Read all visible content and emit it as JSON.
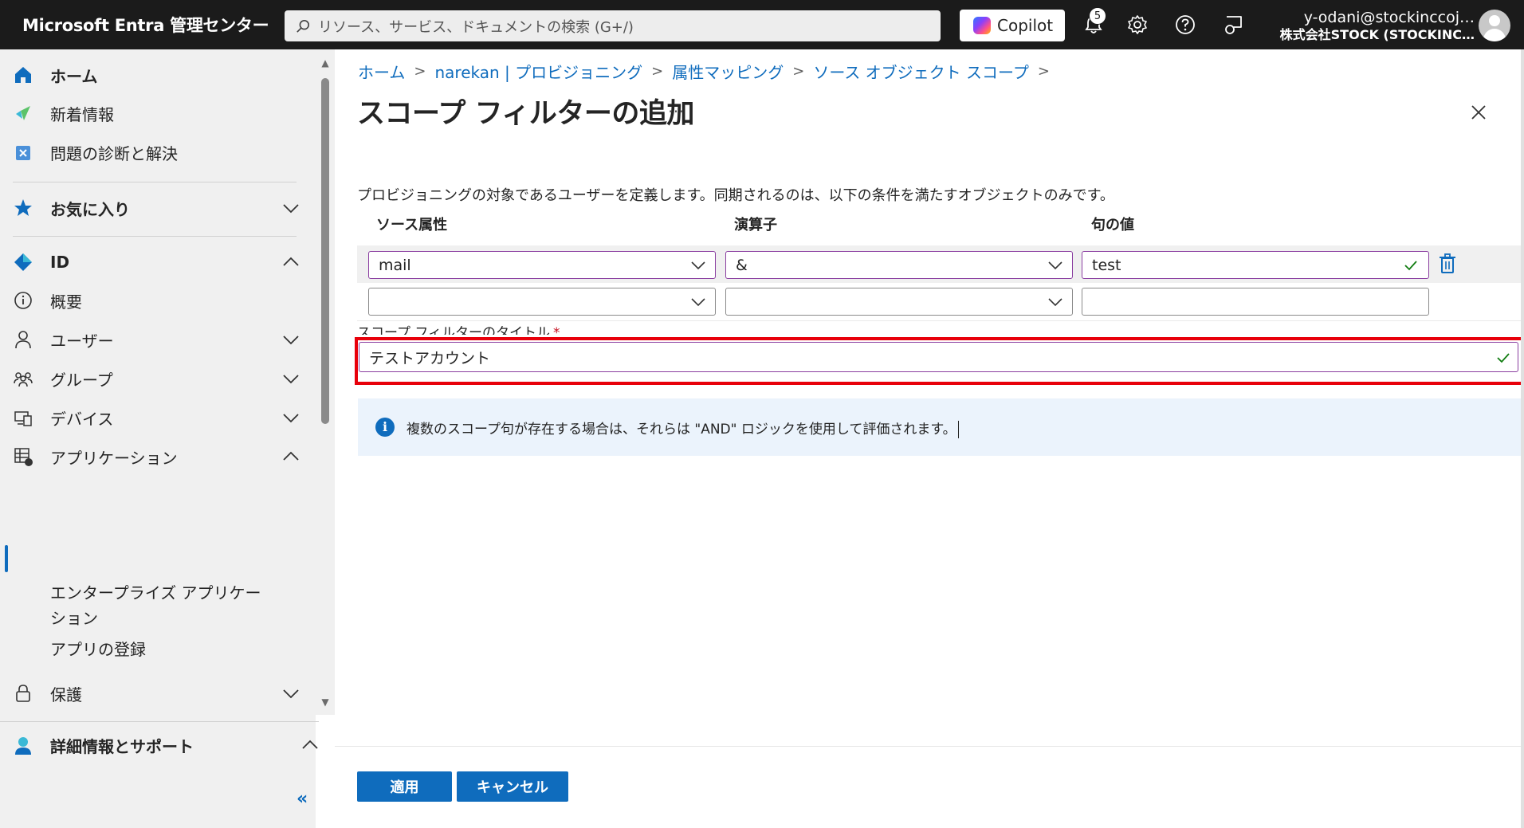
{
  "topbar": {
    "brand": "Microsoft Entra 管理センター",
    "search_placeholder": "リソース、サービス、ドキュメントの検索 (G+/)",
    "copilot_label": "Copilot",
    "notification_count": "5",
    "user_email": "y-odani@stockinccoj…",
    "user_org": "株式会社STOCK (STOCKINC…"
  },
  "sidebar": {
    "home": "ホーム",
    "whats_new": "新着情報",
    "diagnose": "問題の診断と解決",
    "favorites": "お気に入り",
    "identity": "ID",
    "overview": "概要",
    "users": "ユーザー",
    "groups": "グループ",
    "devices": "デバイス",
    "applications": "アプリケーション",
    "enterprise_apps": "エンタープライズ アプリケーション",
    "app_registrations": "アプリの登録",
    "protection": "保護",
    "learn_support": "詳細情報とサポート",
    "collapse_label": "«"
  },
  "breadcrumb": [
    "ホーム",
    "narekan | プロビジョニング",
    "属性マッピング",
    "ソース オブジェクト スコープ"
  ],
  "page": {
    "title": "スコープ フィルターの追加",
    "more": "…",
    "description": "プロビジョニングの対象であるユーザーを定義します。同期されるのは、以下の条件を満たすオブジェクトのみです。",
    "col_source": "ソース属性",
    "col_operator": "演算子",
    "col_value": "句の値",
    "row1": {
      "source": "mail",
      "operator": "&",
      "value": "test"
    },
    "row2": {
      "source": "",
      "operator": "",
      "value": ""
    },
    "title_label": "スコープ フィルターのタイトル",
    "title_required": "*",
    "title_value": "テストアカウント",
    "info_text": "複数のスコープ句が存在する場合は、それらは \"AND\" ロジックを使用して評価されます。",
    "apply_button": "適用",
    "cancel_button": "キャンセル"
  },
  "colors": {
    "accent": "#0f6cbd",
    "highlight": "#e8000b",
    "topbar": "#1b1b1b",
    "success": "#107c10"
  }
}
